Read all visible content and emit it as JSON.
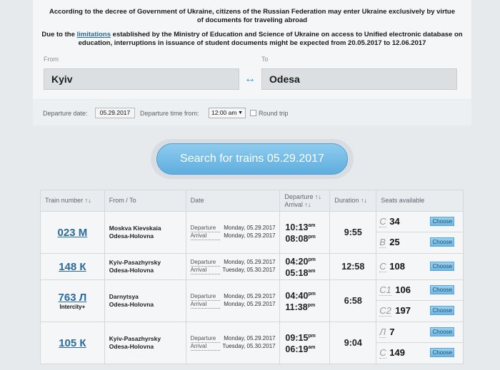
{
  "notice": {
    "line1": "According to the decree of Government of Ukraine, citizens of the Russian Federation may enter Ukraine exclusively by virtue of documents for traveling abroad",
    "line2_pre": "Due to the ",
    "line2_link": "limitations",
    "line2_post": " established by the Ministry of Education and Science of Ukraine on access to Unified electronic database on education, interruptions in issuance of student documents might be expected from 20.05.2017 to 12.06.2017"
  },
  "search": {
    "from_label": "From",
    "from_value": "Kyiv",
    "to_label": "To",
    "to_value": "Odesa",
    "departure_date_label": "Departure date:",
    "departure_date": "05.29.2017",
    "departure_time_label": "Departure time from:",
    "departure_time": "12:00 am",
    "round_trip_label": "Round trip",
    "button_label": "Search for trains 05.29.2017"
  },
  "table": {
    "headers": {
      "train": "Train number ↑↓",
      "route": "From / To",
      "date": "Date",
      "dep_arr_1": "Departure ↑↓",
      "dep_arr_2": "Arrival ↑↓",
      "duration": "Duration ↑↓",
      "seats": "Seats available"
    },
    "choose_label": "Choose",
    "dep_label": "Departure",
    "arr_label": "Arrival",
    "rows": [
      {
        "number": "023 М",
        "class": "",
        "from": "Moskva Kievskaia",
        "to": "Odesa-Holovna",
        "dep_date": "Monday, 05.29.2017",
        "arr_date": "Monday, 05.29.2017",
        "dep_time": "10:13",
        "dep_ampm": "am",
        "arr_time": "08:08",
        "arr_ampm": "pm",
        "duration": "9:55",
        "seats": [
          {
            "cls": "С",
            "count": "34"
          },
          {
            "cls": "В",
            "count": "25"
          }
        ]
      },
      {
        "number": "148 К",
        "class": "",
        "from": "Kyiv-Pasazhyrsky",
        "to": "Odesa-Holovna",
        "dep_date": "Monday, 05.29.2017",
        "arr_date": "Tuesday, 05.30.2017",
        "dep_time": "04:20",
        "dep_ampm": "pm",
        "arr_time": "05:18",
        "arr_ampm": "am",
        "duration": "12:58",
        "seats": [
          {
            "cls": "С",
            "count": "108"
          }
        ]
      },
      {
        "number": "763 Л",
        "class": "Intercity+",
        "from": "Darnytsya",
        "to": "Odesa-Holovna",
        "dep_date": "Monday, 05.29.2017",
        "arr_date": "Monday, 05.29.2017",
        "dep_time": "04:40",
        "dep_ampm": "pm",
        "arr_time": "11:38",
        "arr_ampm": "pm",
        "duration": "6:58",
        "seats": [
          {
            "cls": "С1",
            "count": "106"
          },
          {
            "cls": "С2",
            "count": "197"
          }
        ]
      },
      {
        "number": "105 К",
        "class": "",
        "from": "Kyiv-Pasazhyrsky",
        "to": "Odesa-Holovna",
        "dep_date": "Monday, 05.29.2017",
        "arr_date": "Tuesday, 05.30.2017",
        "dep_time": "09:15",
        "dep_ampm": "pm",
        "arr_time": "06:19",
        "arr_ampm": "am",
        "duration": "9:04",
        "seats": [
          {
            "cls": "Л",
            "count": "7"
          },
          {
            "cls": "С",
            "count": "149"
          }
        ]
      }
    ]
  }
}
